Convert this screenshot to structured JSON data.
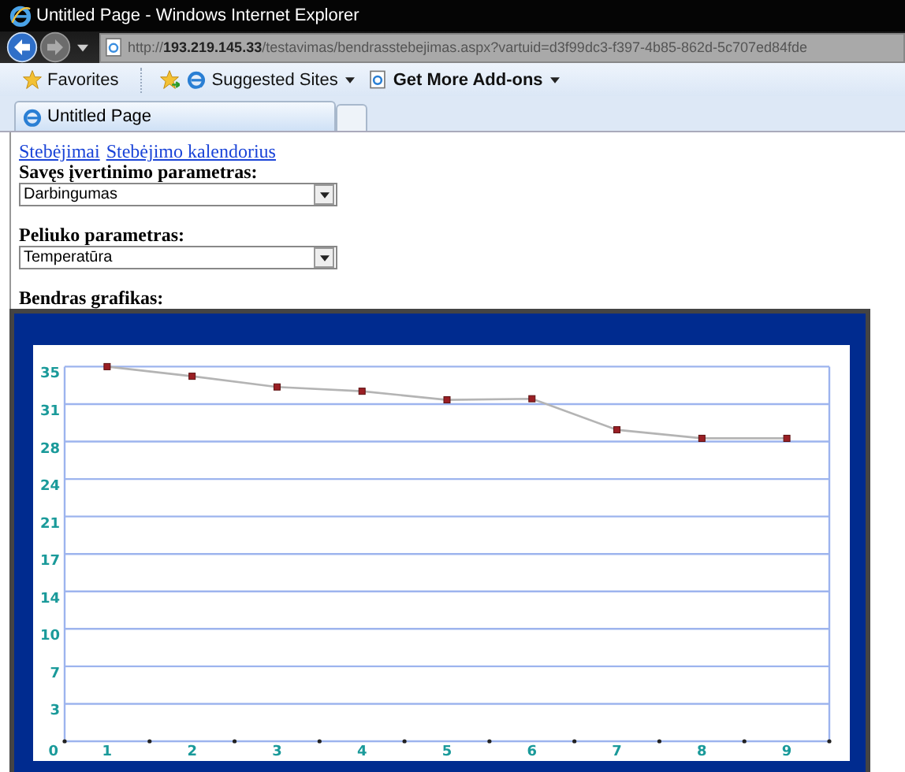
{
  "window": {
    "title": "Untitled Page - Windows Internet Explorer"
  },
  "address_bar": {
    "scheme": "http://",
    "host": "193.219.145.33",
    "path": "/testavimas/bendrasstebejimas.aspx?vartuid=d3f99dc3-f397-4b85-862d-5c707ed84fde"
  },
  "favorites_bar": [
    {
      "label": "Favorites",
      "kind": "favorites",
      "bold": false,
      "dropdown": false
    },
    {
      "label": "Suggested Sites",
      "kind": "ie",
      "bold": false,
      "dropdown": true
    },
    {
      "label": "Get More Add-ons",
      "kind": "addon",
      "bold": true,
      "dropdown": true
    }
  ],
  "tabs": [
    {
      "label": "Untitled Page",
      "selected": true
    }
  ],
  "page": {
    "links": [
      "Stebėjimai",
      "Stebėjimo kalendorius"
    ],
    "fields": [
      {
        "label": "Savęs įvertinimo parametras:",
        "value": "Darbingumas"
      },
      {
        "label": "Peliuko parametras:",
        "value": "Temperatūra"
      }
    ],
    "chart_heading": "Bendras grafikas:",
    "chart_data": {
      "type": "line",
      "grid": true,
      "categories": [
        "1",
        "2",
        "3",
        "4",
        "5",
        "6",
        "7",
        "8",
        "9"
      ],
      "series": [
        {
          "color": "#b4b4b4",
          "marker": true,
          "values": [
            35.0,
            34.1,
            33.1,
            32.7,
            31.9,
            32.0,
            29.1,
            28.3,
            28.3
          ]
        }
      ],
      "ylim": [
        0,
        35
      ],
      "yticks": [
        {
          "value": 0,
          "label": "0"
        },
        {
          "value": 3.5,
          "label": "3"
        },
        {
          "value": 7,
          "label": "7"
        },
        {
          "value": 10.5,
          "label": "10"
        },
        {
          "value": 14,
          "label": "14"
        },
        {
          "value": 17.5,
          "label": "17"
        },
        {
          "value": 21,
          "label": "21"
        },
        {
          "value": 24.5,
          "label": "24"
        },
        {
          "value": 28,
          "label": "28"
        },
        {
          "value": 31.5,
          "label": "31"
        },
        {
          "value": 35,
          "label": "35"
        }
      ]
    }
  }
}
